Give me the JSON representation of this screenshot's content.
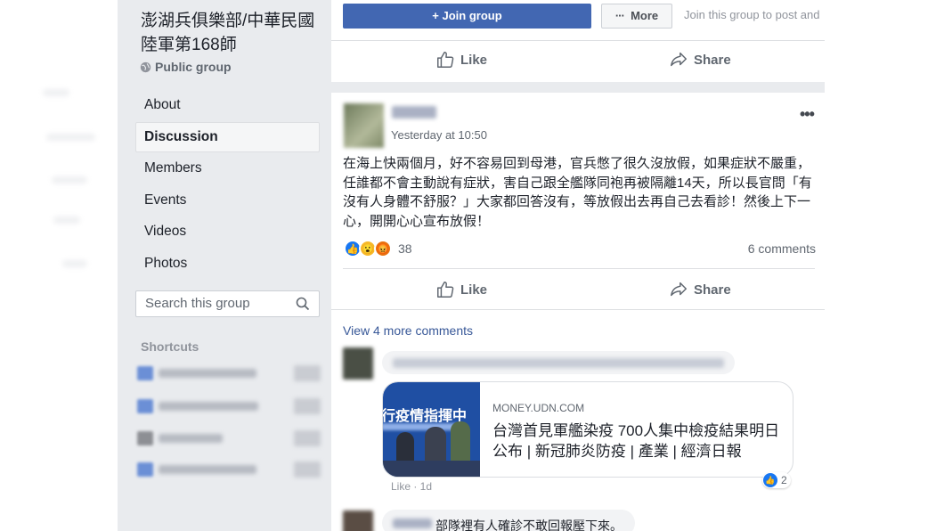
{
  "group": {
    "title": "澎湖兵俱樂部/中華民國陸軍第168師",
    "type_label": "Public group"
  },
  "sidebar": {
    "items": [
      {
        "label": "About"
      },
      {
        "label": "Discussion"
      },
      {
        "label": "Members"
      },
      {
        "label": "Events"
      },
      {
        "label": "Videos"
      },
      {
        "label": "Photos"
      }
    ],
    "search_placeholder": "Search this group",
    "shortcuts_heading": "Shortcuts"
  },
  "toolbar": {
    "join_label": "Join group",
    "more_label": "More",
    "join_hint": "Join this group to post and"
  },
  "actions": {
    "like_label": "Like",
    "share_label": "Share"
  },
  "post": {
    "time": "Yesterday at 10:50",
    "text": "在海上快兩個月，好不容易回到母港，官兵憋了很久沒放假，如果症狀不嚴重，任誰都不會主動說有症狀，害自己跟全艦隊同袍再被隔離14天，所以長官問「有沒有人身體不舒服？」大家都回答沒有，等放假出去再自己去看診！然後上下一心，開開心心宣布放假！",
    "reaction_count": "38",
    "comments_count": "6 comments",
    "view_more": "View 4 more comments"
  },
  "comment1": {
    "link_domain": "MONEY.UDN.COM",
    "link_title": "台灣首見軍艦染疫 700人集中檢疫結果明日公布 | 新冠肺炎防疫 | 產業 | 經濟日報",
    "image_sign_text": "行疫情指揮中",
    "meta": "Like · 1d",
    "like_badge_count": "2"
  },
  "comment2": {
    "text": "部隊裡有人確診不敢回報壓下來。"
  },
  "colors": {
    "sidebar_bg": "#e9ebee",
    "accent": "#4267b2",
    "link": "#385898"
  }
}
